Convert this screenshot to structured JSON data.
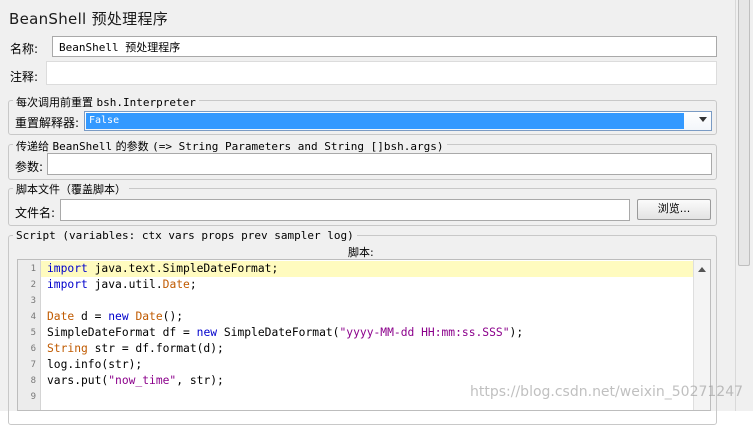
{
  "header": {
    "title": "BeanShell 预处理程序"
  },
  "name_row": {
    "label": "名称:",
    "value": "BeanShell 预处理程序"
  },
  "comment_row": {
    "label": "注释:",
    "value": ""
  },
  "reset_group": {
    "legend_cn": "每次调用前重置",
    "legend_code": "bsh.Interpreter",
    "label": "重置解释器:",
    "selected": "False"
  },
  "params_group": {
    "legend_cn1": "传递给",
    "legend_code1": "BeanShell",
    "legend_cn2": "的参数",
    "legend_code2": "(=> String Parameters and String []bsh.args)",
    "label": "参数:",
    "value": ""
  },
  "file_group": {
    "legend": "脚本文件（覆盖脚本）",
    "label": "文件名:",
    "value": "",
    "browse_label": "浏览..."
  },
  "script_group": {
    "legend": "Script (variables: ctx vars props prev sampler log)",
    "caption": "脚本:"
  },
  "editor": {
    "line_numbers": [
      "1",
      "2",
      "3",
      "4",
      "5",
      "6",
      "7",
      "8",
      "9"
    ],
    "lines": [
      "import java.text.SimpleDateFormat;",
      "import java.util.Date;",
      "",
      "Date d = new Date();",
      "SimpleDateFormat df = new SimpleDateFormat(\"yyyy-MM-dd HH:mm:ss.SSS\");",
      "String str = df.format(d);",
      "log.info(str);",
      "vars.put(\"now_time\", str);",
      ""
    ]
  },
  "watermark": "https://blog.csdn.net/weixin_50271247",
  "colors": {
    "selection": "#3399ff",
    "highlight_line": "#fffbbf",
    "keyword": "#0000cc",
    "type": "#c05a00",
    "string": "#8b008b"
  },
  "icons": {
    "dropdown": "chevron-down-icon",
    "scroll_up": "arrow-up-icon"
  }
}
